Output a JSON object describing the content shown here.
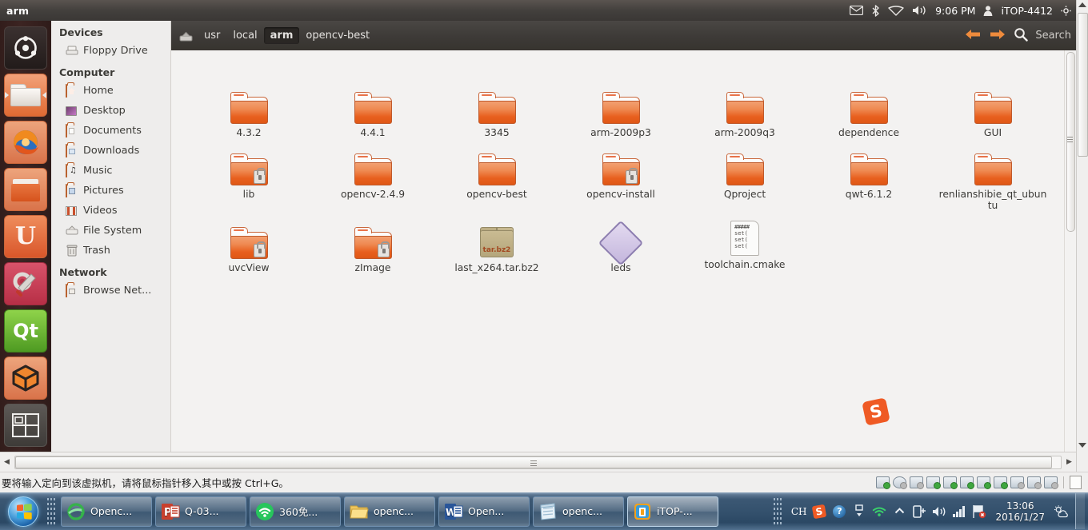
{
  "ubuntu_menubar": {
    "app_title": "arm",
    "clock": "9:06 PM",
    "username": "iTOP-4412",
    "indicators": [
      "mail-icon",
      "bluetooth-icon",
      "network-icon",
      "volume-icon",
      "gear-icon"
    ]
  },
  "launcher": {
    "items": [
      {
        "name": "ubuntu-dash-icon",
        "label": "Dash home"
      },
      {
        "name": "files-nautilus-icon",
        "label": "Files",
        "running": true
      },
      {
        "name": "firefox-icon",
        "label": "Firefox Web Browser"
      },
      {
        "name": "ubuntu-software-center-icon",
        "label": "Ubuntu Software Center"
      },
      {
        "name": "ubuntu-one-icon",
        "label": "Ubuntu One"
      },
      {
        "name": "system-settings-icon",
        "label": "System Settings"
      },
      {
        "name": "qt-creator-icon",
        "label": "Qt Creator"
      },
      {
        "name": "virtualbox-icon",
        "label": "VirtualBox"
      },
      {
        "name": "workspace-switcher-icon",
        "label": "Workspace Switcher"
      }
    ]
  },
  "sidebar": {
    "groups": [
      {
        "title": "Devices",
        "items": [
          {
            "label": "Floppy Drive",
            "icon": "floppy-drive-icon"
          }
        ]
      },
      {
        "title": "Computer",
        "items": [
          {
            "label": "Home",
            "icon": "home-folder-icon"
          },
          {
            "label": "Desktop",
            "icon": "desktop-folder-icon"
          },
          {
            "label": "Documents",
            "icon": "documents-folder-icon"
          },
          {
            "label": "Downloads",
            "icon": "downloads-folder-icon"
          },
          {
            "label": "Music",
            "icon": "music-folder-icon"
          },
          {
            "label": "Pictures",
            "icon": "pictures-folder-icon"
          },
          {
            "label": "Videos",
            "icon": "videos-folder-icon"
          },
          {
            "label": "File System",
            "icon": "file-system-icon"
          },
          {
            "label": "Trash",
            "icon": "trash-icon"
          }
        ]
      },
      {
        "title": "Network",
        "items": [
          {
            "label": "Browse Net...",
            "icon": "network-folder-icon"
          }
        ]
      }
    ]
  },
  "toolbar": {
    "crumbs": [
      {
        "label": "usr",
        "current": false
      },
      {
        "label": "local",
        "current": false
      },
      {
        "label": "arm",
        "current": true
      },
      {
        "label": "opencv-best",
        "current": false
      }
    ],
    "back_icon": "arrow-left-icon",
    "forward_icon": "arrow-right-icon",
    "search_icon": "search-icon",
    "search_placeholder": "Search"
  },
  "files": [
    {
      "name": "4.3.2",
      "type": "folder",
      "locked": false
    },
    {
      "name": "4.4.1",
      "type": "folder",
      "locked": false
    },
    {
      "name": "3345",
      "type": "folder",
      "locked": false
    },
    {
      "name": "arm-2009p3",
      "type": "folder",
      "locked": false
    },
    {
      "name": "arm-2009q3",
      "type": "folder",
      "locked": false
    },
    {
      "name": "dependence",
      "type": "folder",
      "locked": false
    },
    {
      "name": "GUI",
      "type": "folder",
      "locked": false
    },
    {
      "name": "lib",
      "type": "folder",
      "locked": true
    },
    {
      "name": "opencv-2.4.9",
      "type": "folder",
      "locked": false
    },
    {
      "name": "opencv-best",
      "type": "folder",
      "locked": false
    },
    {
      "name": "opencv-install",
      "type": "folder",
      "locked": true
    },
    {
      "name": "Qproject",
      "type": "folder",
      "locked": false
    },
    {
      "name": "qwt-6.1.2",
      "type": "folder",
      "locked": false
    },
    {
      "name": "renlianshibie_qt_ubuntu",
      "type": "folder",
      "locked": false
    },
    {
      "name": "uvcView",
      "type": "folder",
      "locked": true
    },
    {
      "name": "zImage",
      "type": "folder",
      "locked": true
    },
    {
      "name": "last_x264.tar.bz2",
      "type": "archive",
      "locked": false,
      "ext_badge": "tar.bz2"
    },
    {
      "name": "leds",
      "type": "unknown",
      "locked": false
    },
    {
      "name": "toolchain.cmake",
      "type": "textfile",
      "locked": false,
      "preview": [
        "#####",
        "set(",
        "set(",
        "set("
      ]
    }
  ],
  "watermark": {
    "label": "S"
  },
  "vmware": {
    "status_message": "要将输入定向到该虚拟机，请将鼠标指针移入其中或按 Ctrl+G。",
    "device_icons": [
      "hard-disk-icon",
      "cd-dvd-icon",
      "floppy-icon",
      "network-adapter-icon",
      "printer-icon",
      "usb-device-icon",
      "usb-device-2-icon",
      "sound-card-icon",
      "usb-drive-icon",
      "usb-drive-2-icon",
      "camera-icon",
      "notes-icon"
    ]
  },
  "taskbar": {
    "start_label": "Start",
    "buttons": [
      {
        "label": "Openc...",
        "icon": "internet-explorer-icon"
      },
      {
        "label": "Q-03...",
        "icon": "powerpoint-icon"
      },
      {
        "label": "360免...",
        "icon": "360-wifi-icon"
      },
      {
        "label": "openc...",
        "icon": "folder-explorer-icon"
      },
      {
        "label": "Open...",
        "icon": "word-icon"
      },
      {
        "label": "openc...",
        "icon": "notepad-icon"
      },
      {
        "label": "iTOP-...",
        "icon": "vmware-icon"
      }
    ],
    "tray": {
      "items": [
        {
          "name": "input-language-indicator",
          "label": "CH"
        },
        {
          "name": "sogou-pinyin-icon",
          "label": "S"
        },
        {
          "name": "help-icon",
          "label": "?"
        },
        {
          "name": "show-hidden-icons-icon",
          "label": ""
        },
        {
          "name": "360-wifi-tray-icon",
          "label": ""
        },
        {
          "name": "show-more-icon",
          "label": ""
        },
        {
          "name": "safely-remove-hardware-icon",
          "label": ""
        },
        {
          "name": "volume-icon",
          "label": ""
        },
        {
          "name": "signal-strength-icon",
          "label": ""
        },
        {
          "name": "action-center-flag-icon",
          "label": ""
        }
      ],
      "clock_time": "13:06",
      "clock_date": "2016/1/27",
      "weather_icon": "weather-partly-cloudy-icon"
    }
  }
}
